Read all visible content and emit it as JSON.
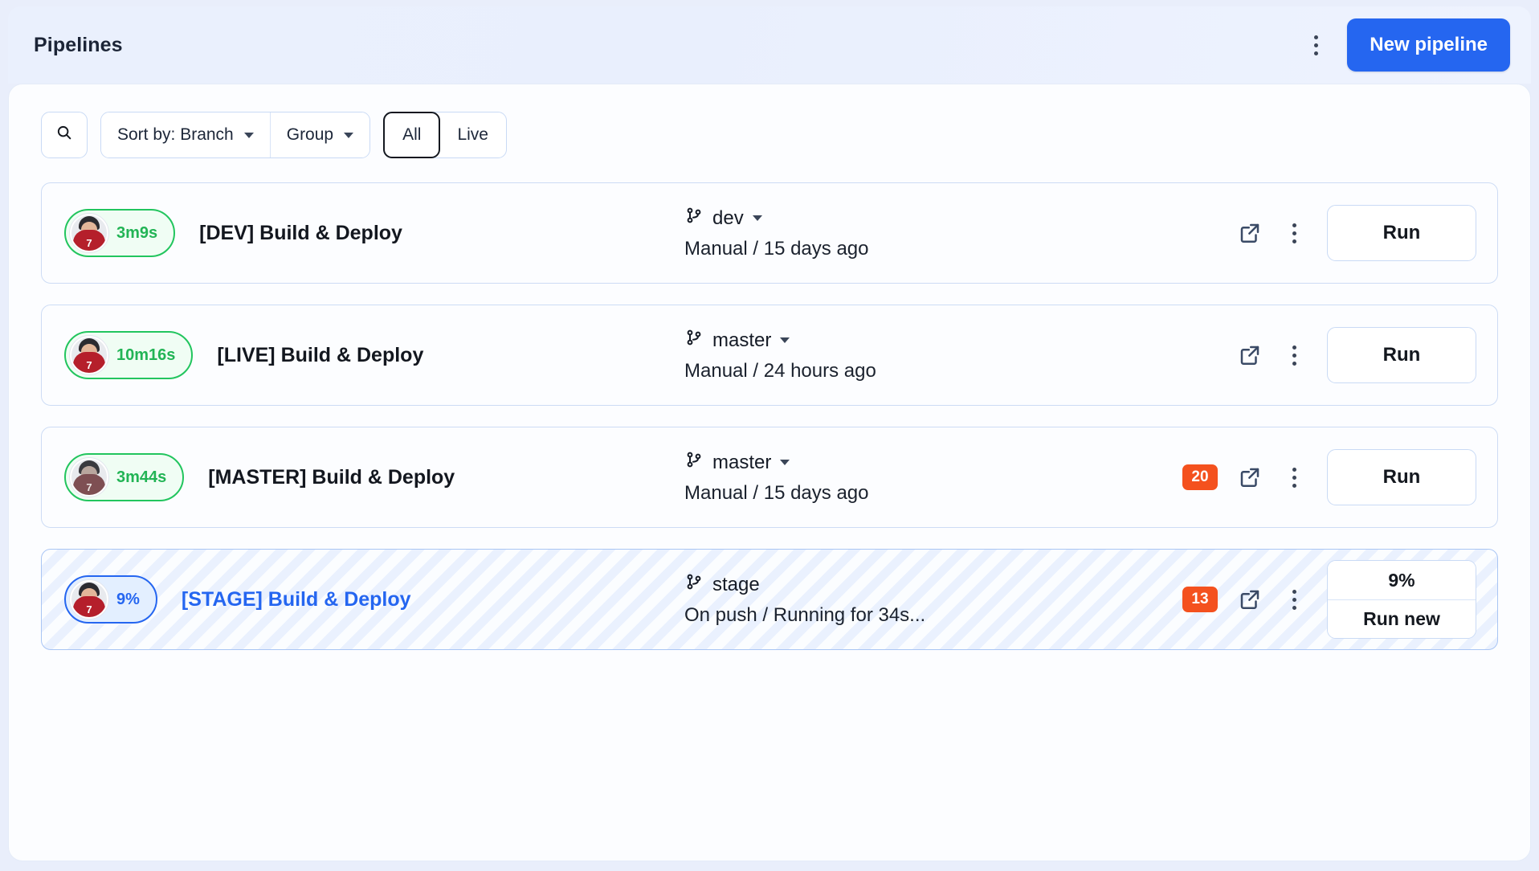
{
  "header": {
    "title": "Pipelines",
    "menu_icon": "kebab-menu-icon",
    "new_pipeline_label": "New pipeline",
    "accent_color": "#2566f0"
  },
  "toolbar": {
    "search_icon": "search-icon",
    "sort_label": "Sort by: Branch",
    "group_label": "Group",
    "toggles": [
      {
        "label": "All",
        "active": true
      },
      {
        "label": "Live",
        "active": false
      }
    ]
  },
  "colors": {
    "success": "#22c55e",
    "success_text": "#22b455",
    "running": "#2566f0",
    "badge": "#f4511e",
    "card_bg": "#fcfdff",
    "page_bg": "#e9eefb"
  },
  "pipelines": [
    {
      "status": "success",
      "duration": "3m9s",
      "avatar_number": "7",
      "avatar_style": "red",
      "title": "[DEV] Build & Deploy",
      "branch": "dev",
      "has_branch_caret": true,
      "meta": "Manual / 15 days ago",
      "count_badge": null,
      "open_icon": "external-link-icon",
      "menu_icon": "kebab-menu-icon",
      "action_label": "Run",
      "action_type": "single"
    },
    {
      "status": "success",
      "duration": "10m16s",
      "avatar_number": "7",
      "avatar_style": "red",
      "title": "[LIVE] Build & Deploy",
      "branch": "master",
      "has_branch_caret": true,
      "meta": "Manual / 24 hours ago",
      "count_badge": null,
      "open_icon": "external-link-icon",
      "menu_icon": "kebab-menu-icon",
      "action_label": "Run",
      "action_type": "single"
    },
    {
      "status": "success",
      "duration": "3m44s",
      "avatar_number": "7",
      "avatar_style": "gray",
      "title": "[MASTER] Build & Deploy",
      "branch": "master",
      "has_branch_caret": true,
      "meta": "Manual / 15 days ago",
      "count_badge": "20",
      "open_icon": "external-link-icon",
      "menu_icon": "kebab-menu-icon",
      "action_label": "Run",
      "action_type": "single"
    },
    {
      "status": "running",
      "duration": "9%",
      "avatar_number": "7",
      "avatar_style": "red",
      "title": "[STAGE] Build & Deploy",
      "branch": "stage",
      "has_branch_caret": false,
      "meta": "On push / Running for 34s...",
      "count_badge": "13",
      "open_icon": "external-link-icon",
      "menu_icon": "kebab-menu-icon",
      "action_label": "Run new",
      "action_progress": "9%",
      "action_type": "split"
    }
  ]
}
